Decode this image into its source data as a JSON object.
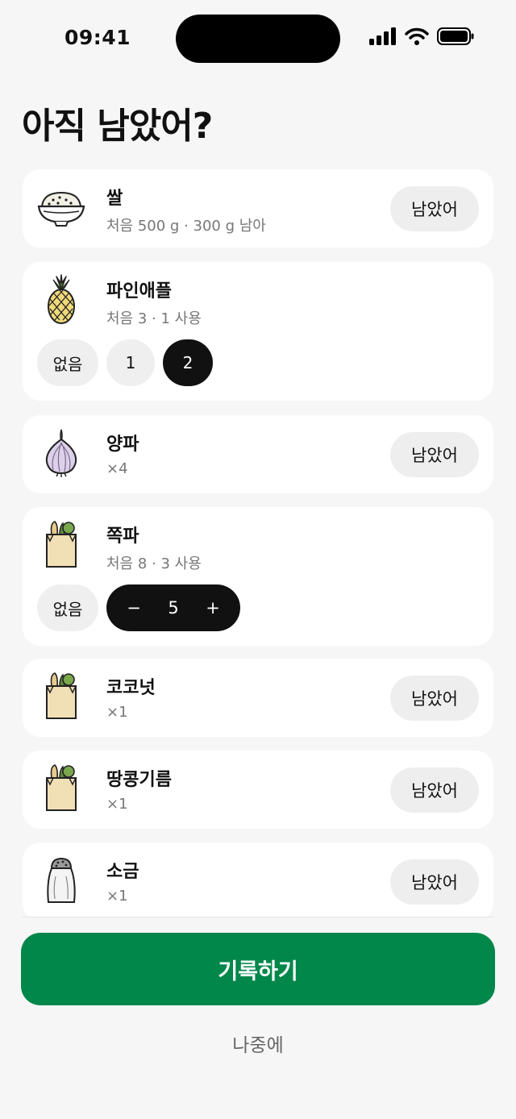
{
  "status_bar": {
    "time": "09:41"
  },
  "title": "아직 남았어?",
  "items": [
    {
      "name": "쌀",
      "sub": "처음 500 g · 300 g 남아",
      "action": "남았어",
      "icon": "rice-bowl-icon"
    },
    {
      "name": "파인애플",
      "sub": "처음 3 · 1 사용",
      "icon": "pineapple-icon",
      "options": [
        "없음",
        "1",
        "2"
      ],
      "selected": "2"
    },
    {
      "name": "양파",
      "sub": "×4",
      "action": "남았어",
      "icon": "onion-icon"
    },
    {
      "name": "쪽파",
      "sub": "처음 8 · 3 사용",
      "icon": "grocery-bag-icon",
      "none_label": "없음",
      "stepper": {
        "minus": "−",
        "value": "5",
        "plus": "+"
      }
    },
    {
      "name": "코코넛",
      "sub": "×1",
      "action": "남았어",
      "icon": "grocery-bag-icon"
    },
    {
      "name": "땅콩기름",
      "sub": "×1",
      "action": "남았어",
      "icon": "grocery-bag-icon"
    },
    {
      "name": "소금",
      "sub": "×1",
      "action": "남았어",
      "icon": "salt-shaker-icon"
    }
  ],
  "primary_button": "기록하기",
  "secondary_button": "나중에",
  "colors": {
    "accent": "#02874a",
    "background": "#f6f6f6",
    "card": "#ffffff",
    "dark": "#111111"
  }
}
